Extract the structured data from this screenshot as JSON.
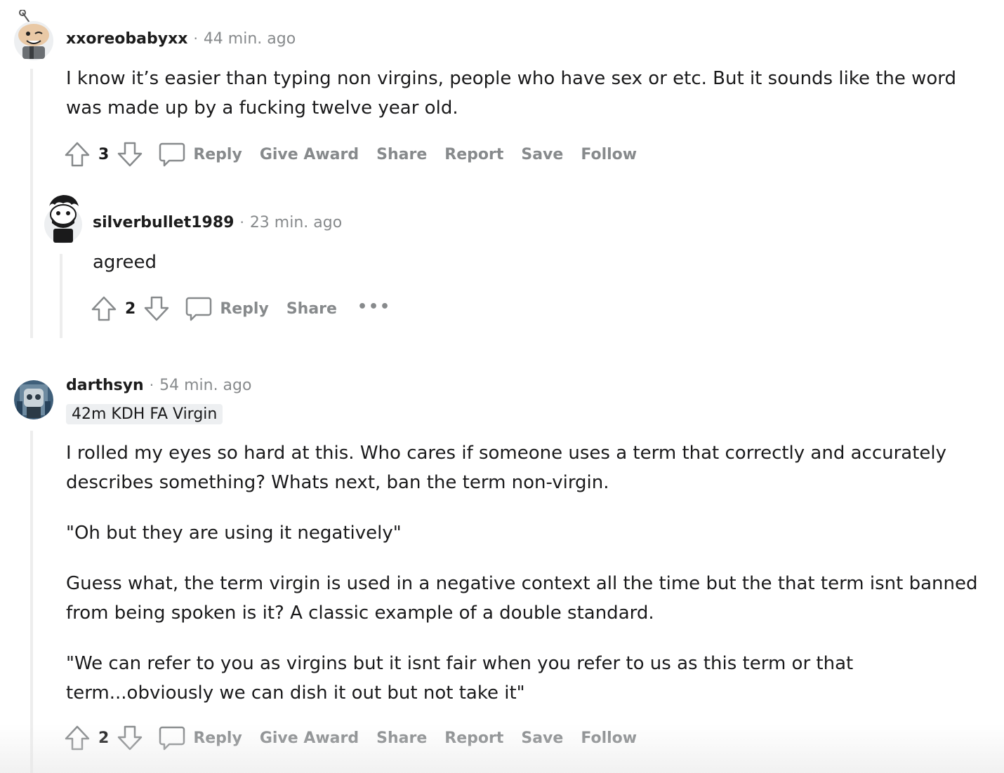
{
  "comments": [
    {
      "username": "xxoreobabyxx",
      "time": "44 min. ago",
      "body": [
        "I know it’s easier than typing non virgins, people who have sex or etc. But it sounds like the word was made up by a fucking twelve year old."
      ],
      "votes": "3",
      "actions": {
        "reply": "Reply",
        "give_award": "Give Award",
        "share": "Share",
        "report": "Report",
        "save": "Save",
        "follow": "Follow"
      }
    },
    {
      "username": "silverbullet1989",
      "time": "23 min. ago",
      "body": [
        "agreed"
      ],
      "votes": "2",
      "actions": {
        "reply": "Reply",
        "share": "Share",
        "more": "•••"
      }
    },
    {
      "username": "darthsyn",
      "time": "54 min. ago",
      "flair": "42m KDH FA Virgin",
      "body": [
        "I rolled my eyes so hard at this. Who cares if someone uses a term that correctly and accurately describes something? Whats next, ban the term non-virgin.",
        "\"Oh but they are using it negatively\"",
        "Guess what, the term virgin is used in a negative context all the time but the that term isnt banned from being spoken is it? A classic example of a double standard.",
        "\"We can refer to you as virgins but it isnt fair when you refer to us as this term or that term...obviously we can dish it out but not take it\""
      ],
      "votes": "2",
      "actions": {
        "reply": "Reply",
        "give_award": "Give Award",
        "share": "Share",
        "report": "Report",
        "save": "Save",
        "follow": "Follow"
      }
    }
  ],
  "meta_separator": "·",
  "colors": {
    "meta_gray": "#878a8c",
    "thread_line": "#ededed",
    "flair_bg": "#edeff1"
  },
  "icons": [
    "upvote-icon",
    "downvote-icon",
    "comment-bubble-icon",
    "more-dots-icon"
  ]
}
